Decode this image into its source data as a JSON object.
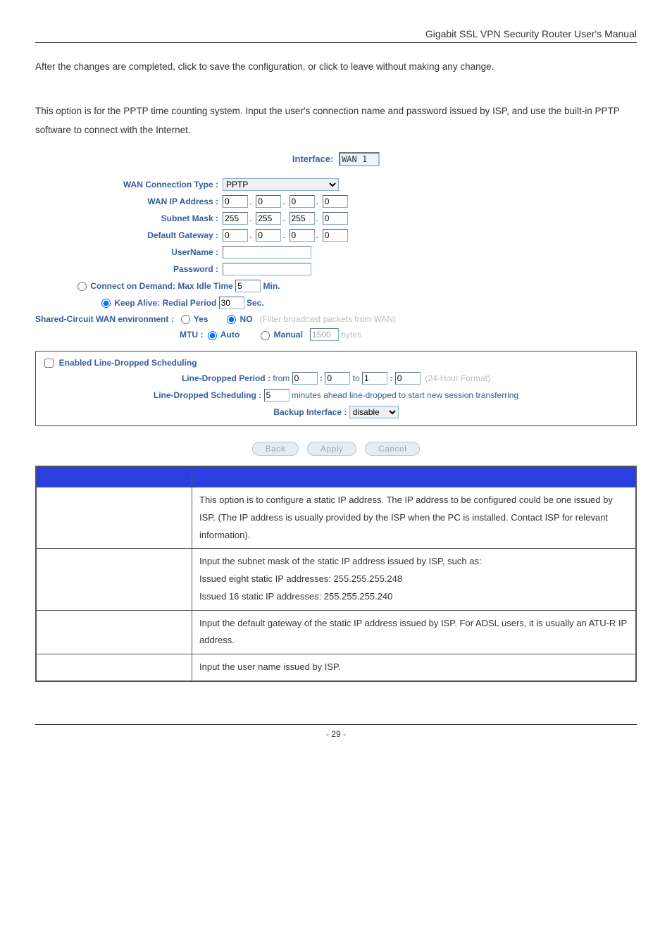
{
  "header": {
    "title": "Gigabit  SSL  VPN  Security  Router  User's  Manual"
  },
  "intro1": "After the changes are completed, click                to save the configuration, or click               to leave without making any change.",
  "intro2": "This option is for the PPTP time counting system. Input the user's connection name and password issued by ISP, and use the built-in PPTP software to connect with the Internet.",
  "interface": {
    "label": "Interface:",
    "value": "WAN 1"
  },
  "form": {
    "conn_type_label": "WAN  Connection Type :",
    "conn_type_value": "PPTP",
    "wan_ip_label": "WAN  IP Address :",
    "wan_ip": [
      "0",
      "0",
      "0",
      "0"
    ],
    "subnet_label": "Subnet Mask :",
    "subnet": [
      "255",
      "255",
      "255",
      "0"
    ],
    "gateway_label": "Default Gateway :",
    "gateway": [
      "0",
      "0",
      "0",
      "0"
    ],
    "user_label": "UserName  :",
    "user_value": "",
    "pass_label": "Password :",
    "pass_value": "",
    "cod_label": "Connect on Demand: Max Idle Time",
    "cod_value": "5",
    "cod_unit": "Min.",
    "ka_label": "Keep Alive: Redial Period",
    "ka_value": "30",
    "ka_unit": "Sec.",
    "shared_label": "Shared-Circuit WAN environment :",
    "yes": "Yes",
    "no": "NO",
    "filter_note": "(Filter broadcast packets from WAN)",
    "mtu_label": "MTU :",
    "auto": "Auto",
    "manual": "Manual",
    "mtu_value": "1500",
    "mtu_unit": "bytes"
  },
  "sched": {
    "title": "Enabled Line-Dropped Scheduling",
    "period_label": "Line-Dropped Period :",
    "from": "from",
    "to": "to",
    "fh": "0",
    "fm": "0",
    "th": "1",
    "tm": "0",
    "hourfmt": "(24-Hour Format)",
    "sched_label": "Line-Dropped Scheduling :",
    "sched_value": "5",
    "sched_suffix": "minutes ahead line-dropped to start new session transferring",
    "backup_label": "Backup Interface :",
    "backup_value": "disable"
  },
  "buttons": {
    "back": "Back",
    "apply": "Apply",
    "cancel": "Cancel"
  },
  "table": {
    "r1": "This option is to configure a static IP address. The IP address to be configured could be one issued by ISP. (The IP address is usually provided by the ISP when the PC is installed. Contact ISP for relevant information).",
    "r2": "Input the subnet mask of the static IP address issued by ISP, such as:\nIssued eight static IP addresses: 255.255.255.248\nIssued 16 static IP addresses: 255.255.255.240",
    "r3": "Input the default gateway of the static IP address issued by ISP. For ADSL users, it is usually an ATU-R IP address.",
    "r4": "Input the user name issued by ISP."
  },
  "footer": {
    "page": "- 29 -"
  }
}
